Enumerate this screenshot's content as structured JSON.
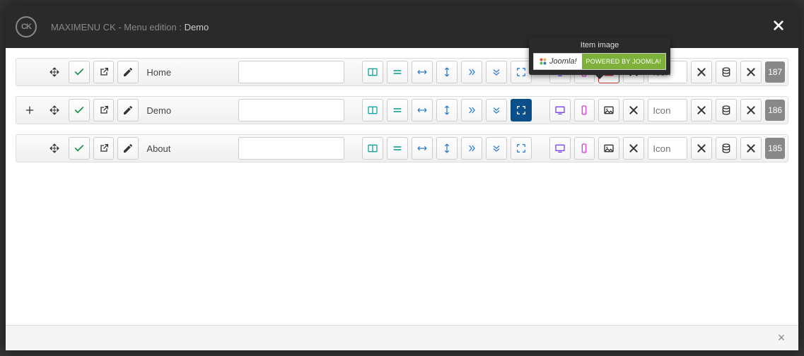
{
  "header": {
    "logo_text": "CK",
    "title_prefix": "MAXIMENU CK - Menu edition : ",
    "title_accent": "Demo"
  },
  "tooltip": {
    "label": "Item image",
    "joomla_text": "Joomla!",
    "powered_text": "POWERED BY JOOMLA!"
  },
  "icon_placeholder": "Icon",
  "rows": [
    {
      "id": "187",
      "name": "Home",
      "show_add": false,
      "fullwidth_active": false,
      "image_active": true
    },
    {
      "id": "186",
      "name": "Demo",
      "show_add": true,
      "fullwidth_active": true,
      "image_active": false
    },
    {
      "id": "185",
      "name": "About",
      "show_add": false,
      "fullwidth_active": false,
      "image_active": false
    }
  ]
}
